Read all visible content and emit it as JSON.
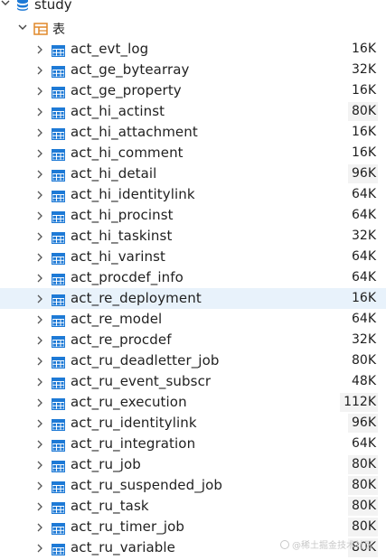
{
  "database": {
    "name": "study",
    "expanded": true,
    "icon": "database-icon"
  },
  "folder": {
    "label": "表",
    "expanded": true,
    "icon": "folder-table-icon"
  },
  "tables": [
    {
      "name": "act_evt_log",
      "size": "16K"
    },
    {
      "name": "act_ge_bytearray",
      "size": "32K"
    },
    {
      "name": "act_ge_property",
      "size": "16K"
    },
    {
      "name": "act_hi_actinst",
      "size": "80K"
    },
    {
      "name": "act_hi_attachment",
      "size": "16K"
    },
    {
      "name": "act_hi_comment",
      "size": "16K"
    },
    {
      "name": "act_hi_detail",
      "size": "96K"
    },
    {
      "name": "act_hi_identitylink",
      "size": "64K"
    },
    {
      "name": "act_hi_procinst",
      "size": "64K"
    },
    {
      "name": "act_hi_taskinst",
      "size": "32K"
    },
    {
      "name": "act_hi_varinst",
      "size": "64K"
    },
    {
      "name": "act_procdef_info",
      "size": "64K"
    },
    {
      "name": "act_re_deployment",
      "size": "16K"
    },
    {
      "name": "act_re_model",
      "size": "64K"
    },
    {
      "name": "act_re_procdef",
      "size": "32K"
    },
    {
      "name": "act_ru_deadletter_job",
      "size": "80K"
    },
    {
      "name": "act_ru_event_subscr",
      "size": "48K"
    },
    {
      "name": "act_ru_execution",
      "size": "112K"
    },
    {
      "name": "act_ru_identitylink",
      "size": "96K"
    },
    {
      "name": "act_ru_integration",
      "size": "64K"
    },
    {
      "name": "act_ru_job",
      "size": "80K"
    },
    {
      "name": "act_ru_suspended_job",
      "size": "80K"
    },
    {
      "name": "act_ru_task",
      "size": "80K"
    },
    {
      "name": "act_ru_timer_job",
      "size": "80K"
    },
    {
      "name": "act_ru_variable",
      "size": "80K"
    }
  ],
  "selected_table": "act_re_deployment",
  "highlighted_sizes": [
    "act_hi_actinst",
    "act_hi_detail",
    "act_ru_execution",
    "act_ru_identitylink",
    "act_ru_job",
    "act_ru_suspended_job",
    "act_ru_task",
    "act_ru_timer_job",
    "act_ru_variable"
  ],
  "watermark": "@稀土掘金技术社区",
  "colors": {
    "icon_blue": "#1e7ad6",
    "folder_orange": "#e0892a",
    "selection": "#e8f2fb"
  }
}
